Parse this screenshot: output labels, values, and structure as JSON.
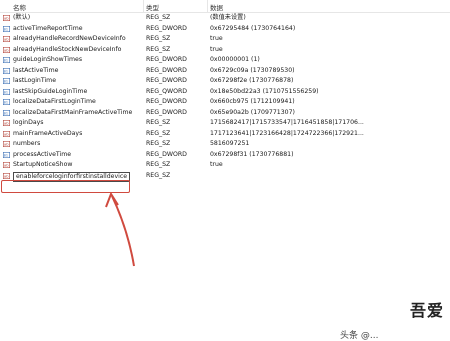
{
  "columns": {
    "name": "名称",
    "type": "类型",
    "data": "数据"
  },
  "rows": [
    {
      "icon": "string-value-icon",
      "name": "(默认)",
      "type": "REG_SZ",
      "data": "(数值未设置)"
    },
    {
      "icon": "binary-value-icon",
      "name": "activeTimeReportTime",
      "type": "REG_DWORD",
      "data": "0x67295484 (1730764164)"
    },
    {
      "icon": "string-value-icon",
      "name": "alreadyHandleRecordNewDeviceInfo",
      "type": "REG_SZ",
      "data": "true"
    },
    {
      "icon": "string-value-icon",
      "name": "alreadyHandleStockNewDeviceInfo",
      "type": "REG_SZ",
      "data": "true"
    },
    {
      "icon": "binary-value-icon",
      "name": "guideLoginShowTimes",
      "type": "REG_DWORD",
      "data": "0x00000001 (1)"
    },
    {
      "icon": "binary-value-icon",
      "name": "lastActiveTime",
      "type": "REG_DWORD",
      "data": "0x6729c09a (1730789530)"
    },
    {
      "icon": "binary-value-icon",
      "name": "lastLoginTime",
      "type": "REG_DWORD",
      "data": "0x67298f2e (1730776878)"
    },
    {
      "icon": "binary-value-icon",
      "name": "lastSkipGuideLoginTime",
      "type": "REG_QWORD",
      "data": "0x18e50bd22a3 (1710751556259)"
    },
    {
      "icon": "binary-value-icon",
      "name": "localizeDataFirstLoginTime",
      "type": "REG_DWORD",
      "data": "0x660cb975 (1712109941)"
    },
    {
      "icon": "binary-value-icon",
      "name": "localizeDataFirstMainFrameActiveTime",
      "type": "REG_DWORD",
      "data": "0x65e90a2b (1709771307)"
    },
    {
      "icon": "string-value-icon",
      "name": "loginDays",
      "type": "REG_SZ",
      "data": "1715682417|1715733547|1716451858|171706..."
    },
    {
      "icon": "string-value-icon",
      "name": "mainFrameActiveDays",
      "type": "REG_SZ",
      "data": "1717123641|1723166428|1724722366|172921..."
    },
    {
      "icon": "string-value-icon",
      "name": "numbers",
      "type": "REG_SZ",
      "data": "5816097251"
    },
    {
      "icon": "binary-value-icon",
      "name": "processActiveTime",
      "type": "REG_DWORD",
      "data": "0x67298f31 (1730776881)"
    },
    {
      "icon": "string-value-icon",
      "name": "StartupNoticeShow",
      "type": "REG_SZ",
      "data": "true"
    },
    {
      "icon": "string-value-icon",
      "name": "enableforceloginforfirstinstalldevice",
      "type": "REG_SZ",
      "data": "",
      "selected": true
    }
  ],
  "watermark": {
    "main": "吾爱",
    "sub": "头条 @..."
  },
  "colors": {
    "annotation": "#d04a3f",
    "string_icon": "#b5473c",
    "binary_icon": "#3a6fb5"
  }
}
